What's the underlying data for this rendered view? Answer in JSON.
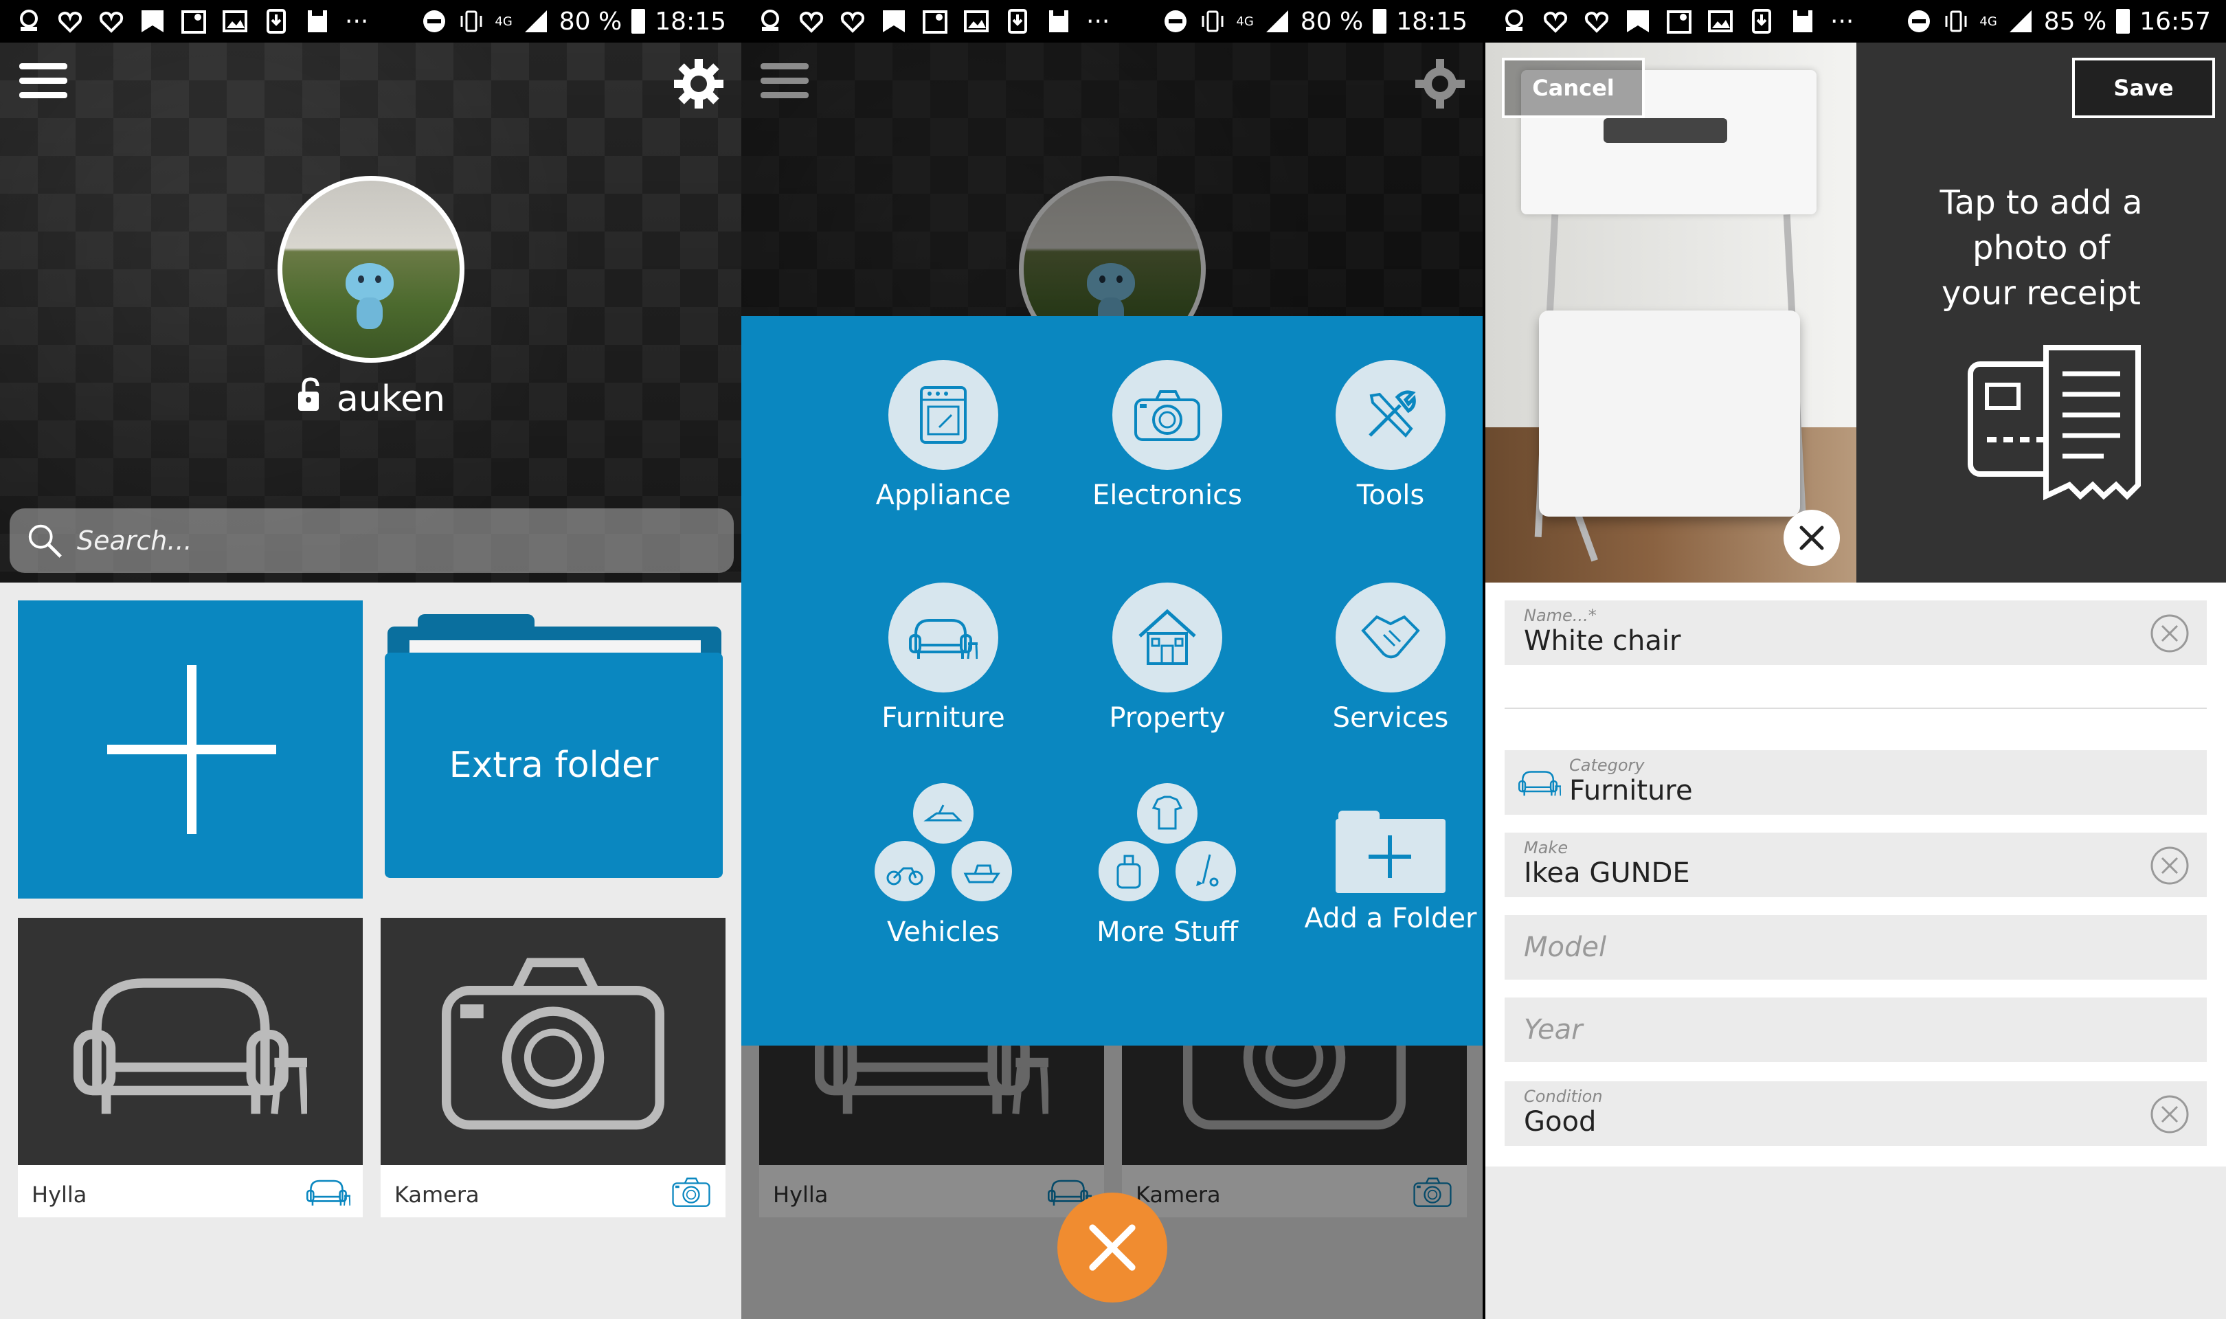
{
  "colors": {
    "accent": "#0a87c0",
    "close_fab": "#f08c30",
    "form_bg": "#ebebeb"
  },
  "statusbars": [
    {
      "battery": "80 %",
      "time": "18:15",
      "network": "4G",
      "overflow": "···"
    },
    {
      "battery": "80 %",
      "time": "18:15",
      "network": "4G",
      "overflow": "···"
    },
    {
      "battery": "85 %",
      "time": "16:57",
      "network": "4G",
      "overflow": "···"
    }
  ],
  "home": {
    "username": "auken",
    "search_placeholder": "Search...",
    "extra_folder_label": "Extra folder",
    "items": [
      {
        "name": "Hylla",
        "icon": "sofa-icon"
      },
      {
        "name": "Kamera",
        "icon": "camera-icon"
      }
    ]
  },
  "add_menu": {
    "categories": [
      {
        "label": "Appliance",
        "icon": "oven-icon"
      },
      {
        "label": "Electronics",
        "icon": "camera-icon"
      },
      {
        "label": "Tools",
        "icon": "tools-icon"
      },
      {
        "label": "Furniture",
        "icon": "sofa-icon"
      },
      {
        "label": "Property",
        "icon": "house-icon"
      },
      {
        "label": "Services",
        "icon": "handshake-icon"
      },
      {
        "label": "Vehicles",
        "icon": "vehicles-icon"
      },
      {
        "label": "More Stuff",
        "icon": "more-stuff-icon"
      },
      {
        "label": "Add a Folder",
        "icon": "add-folder-icon"
      }
    ],
    "background_items": [
      {
        "name": "Hylla"
      },
      {
        "name": "Kamera"
      }
    ]
  },
  "edit_item": {
    "cancel_label": "Cancel",
    "save_label": "Save",
    "receipt_prompt_lines": [
      "Tap to add a",
      "photo of",
      "your receipt"
    ],
    "fields": {
      "name": {
        "label": "Name...*",
        "value": "White chair"
      },
      "category": {
        "label": "Category",
        "value": "Furniture"
      },
      "make": {
        "label": "Make",
        "value": "Ikea GUNDE"
      },
      "model": {
        "placeholder": "Model"
      },
      "year": {
        "placeholder": "Year"
      },
      "condition": {
        "label": "Condition",
        "value": "Good"
      }
    }
  }
}
